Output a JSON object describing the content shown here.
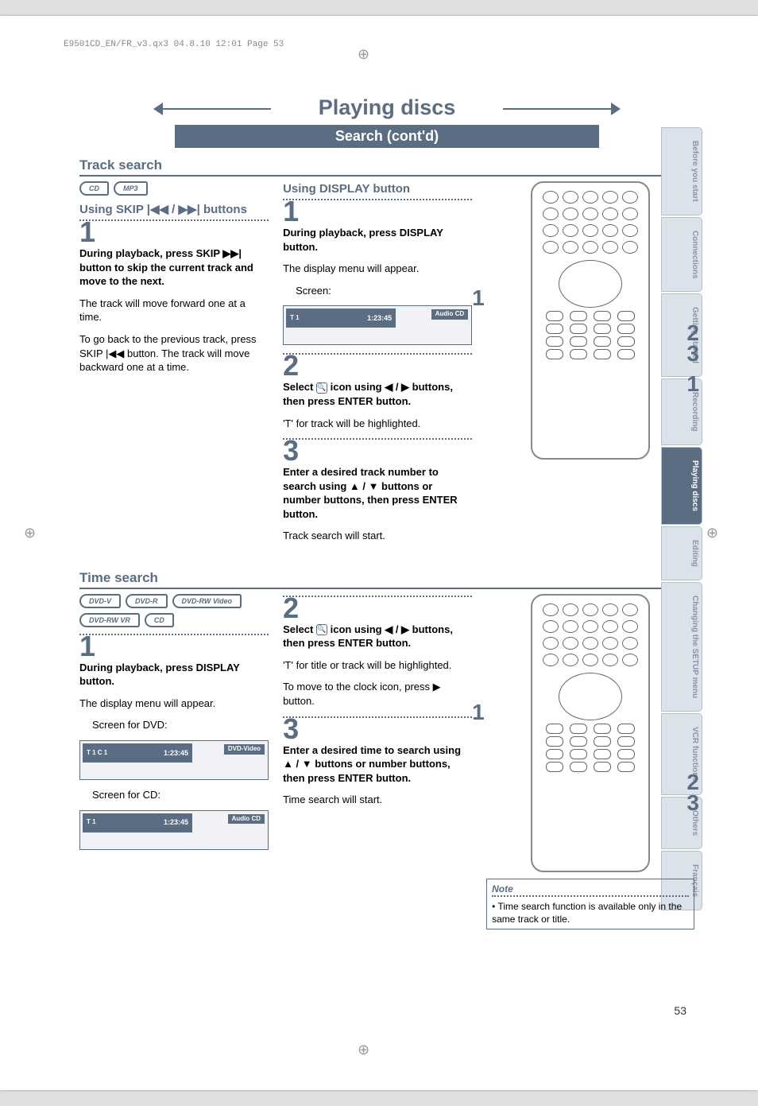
{
  "meta": {
    "header": "E9501CD_EN/FR_v3.qx3  04.8.10  12:01  Page 53"
  },
  "chapter_title": "Playing discs",
  "section_bar": "Search (cont'd)",
  "tabs": {
    "items": [
      "Before you start",
      "Connections",
      "Getting started",
      "Recording",
      "Playing discs",
      "Editing",
      "Changing the SETUP menu",
      "VCR functions",
      "Others",
      "Français"
    ],
    "active_index": 4
  },
  "track_search": {
    "heading": "Track search",
    "media": [
      "CD",
      "MP3"
    ],
    "using_skip": {
      "title": "Using SKIP |◀◀ / ▶▶| buttons",
      "step1_num": "1",
      "step1_bold": "During playback, press SKIP ▶▶| button to skip the current track and move to the next.",
      "step1_body1": "The track will move forward one at a time.",
      "step1_body2": "To go back to the previous track, press SKIP |◀◀ button. The track will move backward one at a time."
    },
    "using_display": {
      "title": "Using DISPLAY button",
      "step1_num": "1",
      "step1_bold": "During playback, press DISPLAY button.",
      "step1_body": "The display menu will appear.",
      "screen_label": "Screen:",
      "osd_time": "1:23:45",
      "osd_track": "T   1",
      "osd_badge": "Audio CD",
      "step2_num": "2",
      "step2_bold_a": "Select ",
      "step2_bold_b": " icon using ◀ / ▶ buttons, then press ENTER button.",
      "step2_body": "'T' for track will be highlighted.",
      "step3_num": "3",
      "step3_bold": "Enter a desired track number to search using ▲ / ▼ buttons or number buttons, then press ENTER button.",
      "step3_body": "Track search will start."
    },
    "callouts": {
      "c1": "1",
      "c2": "2",
      "c3": "3",
      "c4": "1"
    }
  },
  "time_search": {
    "heading": "Time search",
    "media": [
      "DVD-V",
      "DVD-R",
      "DVD-RW Video",
      "DVD-RW VR",
      "CD"
    ],
    "step1_num": "1",
    "step1_bold": "During playback, press DISPLAY button.",
    "step1_body": "The display menu will appear.",
    "screen_dvd_label": "Screen for DVD:",
    "osd_dvd_time": "1:23:45",
    "osd_dvd_track": "T  1  C  1",
    "osd_dvd_badge": "DVD-Video",
    "screen_cd_label": "Screen for CD:",
    "osd_cd_time": "1:23:45",
    "osd_cd_track": "T   1",
    "osd_cd_badge": "Audio CD",
    "step2_num": "2",
    "step2_bold_a": "Select ",
    "step2_bold_b": " icon using ◀ / ▶ buttons, then press ENTER button.",
    "step2_body1": "'T' for title or track will be highlighted.",
    "step2_body2": "To move to the clock icon, press ▶ button.",
    "step3_num": "3",
    "step3_bold": "Enter a desired time to search using ▲ / ▼ buttons or number buttons, then press ENTER button.",
    "step3_body": "Time search will start.",
    "callouts": {
      "c1": "1",
      "c2": "2",
      "c3": "3"
    },
    "note": {
      "title": "Note",
      "body": "• Time search function is available only in the same track or title."
    }
  },
  "page_number": "53"
}
